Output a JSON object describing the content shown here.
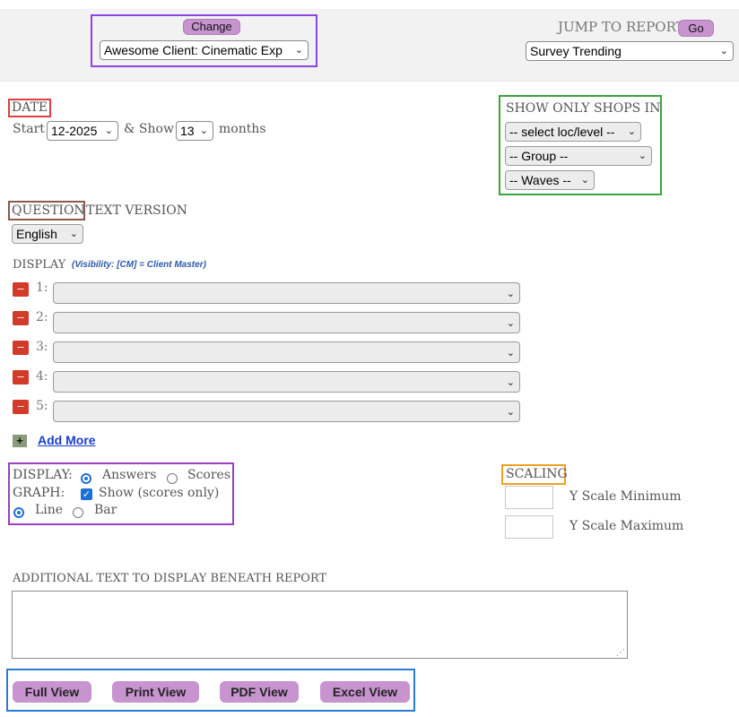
{
  "header": {
    "change_label": "Change",
    "client_select": "Awesome Client: Cinematic Exp",
    "jump_label": "JUMP TO REPORT",
    "go_label": "Go",
    "report_select": "Survey Trending"
  },
  "date": {
    "heading": "DATE",
    "start_label": "Start",
    "start_value": "12-2025",
    "show_label": "& Show",
    "months_value": "13",
    "months_label": "months"
  },
  "shops": {
    "heading": "SHOW ONLY SHOPS IN",
    "location": "-- select loc/level --",
    "group": "-- Group --",
    "waves": "-- Waves --"
  },
  "question": {
    "heading": "QUESTION",
    "heading_rest": "TEXT VERSION",
    "language": "English"
  },
  "display_list": {
    "heading": "DISPLAY",
    "visibility_note": "(Visibility: [CM] = Client Master)",
    "rows": [
      "1:",
      "2:",
      "3:",
      "4:",
      "5:"
    ],
    "add_more": "Add More"
  },
  "options": {
    "display_label": "DISPLAY:",
    "answers": "Answers",
    "scores": "Scores",
    "graph_label": "GRAPH:",
    "show": "Show (scores only)",
    "line": "Line",
    "bar": "Bar"
  },
  "scaling": {
    "heading": "SCALING",
    "min_label": "Y Scale Minimum",
    "max_label": "Y Scale Maximum"
  },
  "additional": {
    "label": "ADDITIONAL TEXT TO DISPLAY BENEATH REPORT"
  },
  "buttons": {
    "full": "Full View",
    "print": "Print View",
    "pdf": "PDF View",
    "excel": "Excel View"
  },
  "colors": {
    "button_purple": "#c794cf",
    "accent_blue": "#1e6fd9",
    "remove_red": "#d23a2a"
  }
}
